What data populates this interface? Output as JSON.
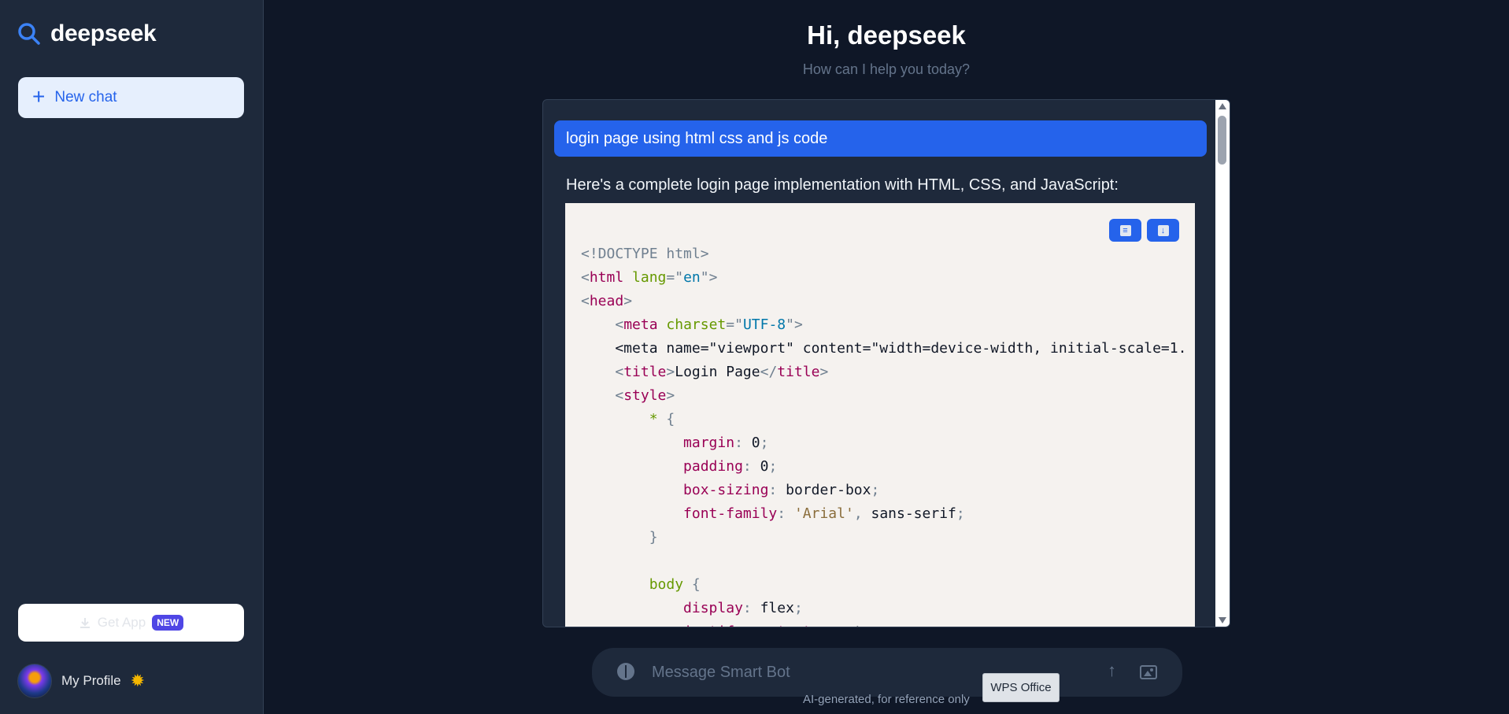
{
  "sidebar": {
    "brand": "deepseek",
    "new_chat_label": "New chat",
    "get_app_label": "Get App",
    "new_badge": "NEW",
    "profile_name": "My Profile"
  },
  "main": {
    "greeting": "Hi, deepseek",
    "subgreeting": "How can I help you today?",
    "user_message": "login page using html css and js code",
    "bot_intro": "Here's a complete login page implementation with HTML, CSS, and JavaScript:",
    "code_lines": [
      "<!DOCTYPE html>",
      "<html lang=\"en\">",
      "<head>",
      "    <meta charset=\"UTF-8\">",
      "    <meta name=\"viewport\" content=\"width=device-width, initial-scale=1.",
      "    <title>Login Page</title>",
      "    <style>",
      "        * {",
      "            margin: 0;",
      "            padding: 0;",
      "            box-sizing: border-box;",
      "            font-family: 'Arial', sans-serif;",
      "        }",
      "",
      "        body {",
      "            display: flex;",
      "            justify-content: center;"
    ]
  },
  "input": {
    "placeholder": "Message Smart Bot"
  },
  "footer": {
    "disclaimer": "AI-generated, for reference only",
    "taskbar_tooltip": "WPS Office"
  },
  "colors": {
    "accent": "#2563eb",
    "background": "#0f1727",
    "sidebar": "#1e293b"
  }
}
